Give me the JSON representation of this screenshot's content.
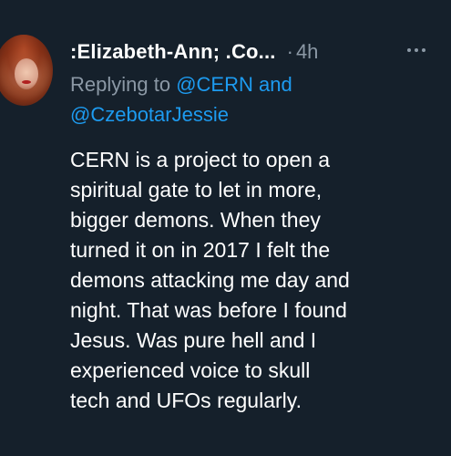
{
  "tweet": {
    "display_name": ":Elizabeth-Ann; .Co...",
    "separator": "·",
    "timestamp": "4h",
    "replying_prefix": "Replying to ",
    "mention_1": "@CERN",
    "conjunction": " and",
    "mention_2": "@CzebotarJessie",
    "body_lines": [
      "CERN is a project to open a",
      "spiritual gate to let in more,",
      "bigger demons. When they",
      "turned it on in 2017 I felt the",
      "demons attacking me day and",
      "night. That was before I found",
      "Jesus.  Was pure hell and I",
      "experienced voice to skull",
      "tech and UFOs regularly."
    ]
  },
  "colors": {
    "background": "#15202b",
    "text": "#ffffff",
    "secondary": "#8b98a5",
    "link": "#1d9bf0"
  },
  "icons": {
    "more": "more-horizontal-icon",
    "avatar": "user-avatar"
  }
}
